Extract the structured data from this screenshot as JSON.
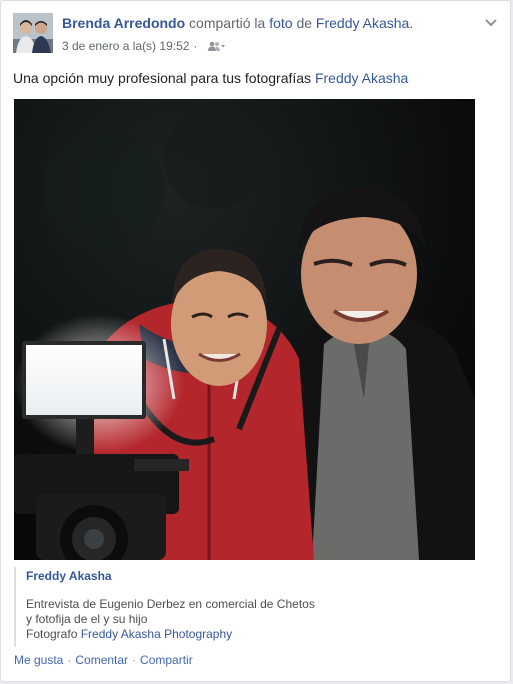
{
  "post": {
    "author": "Brenda Arredondo",
    "action_text": "compartió la",
    "object_link": "foto",
    "preposition": "de",
    "original_author": "Freddy Akasha",
    "trailing": ".",
    "timestamp": "3 de enero a la(s) 19:52",
    "separator": "·",
    "audience_icon": "friends-icon",
    "message_text": "Una opción muy profesional para tus fotografías",
    "message_tag": "Freddy Akasha"
  },
  "shared": {
    "author": "Freddy Akasha",
    "desc_line1": "Entrevista de Eugenio Derbez en comercial de Chetos",
    "desc_line2": "y fotofija de el y su hijo",
    "desc_line3_prefix": "Fotografo",
    "desc_line3_link": "Freddy Akasha Photography"
  },
  "actions": {
    "like": "Me gusta",
    "comment": "Comentar",
    "share": "Compartir",
    "sep": "·"
  },
  "colors": {
    "link": "#365899",
    "action_link": "#4267b2",
    "muted": "#616770",
    "card_border": "#dddfe2"
  }
}
